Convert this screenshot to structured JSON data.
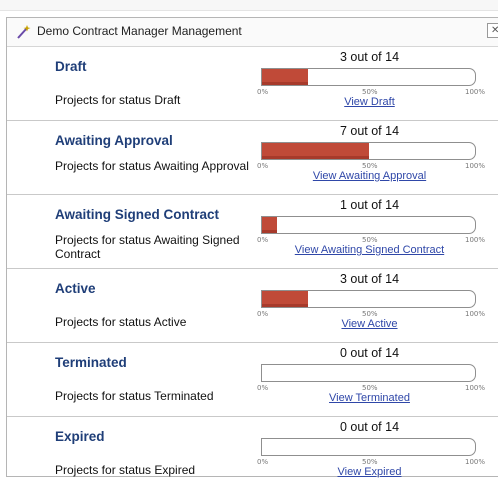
{
  "window": {
    "title": "Demo Contract Manager Management",
    "close_label": "✕",
    "icon": "wand-icon"
  },
  "scale": {
    "min": "0%",
    "mid": "50%",
    "max": "100%"
  },
  "colors": {
    "bar_fill": "#c04a38",
    "title_blue": "#1f3e78",
    "link_blue": "#2f47a8"
  },
  "statuses": [
    {
      "name": "Draft",
      "description": "Projects for status Draft",
      "count_text": "3 out of 14",
      "count": 3,
      "total": 14,
      "link": "View Draft"
    },
    {
      "name": "Awaiting Approval",
      "description": "Projects for status Awaiting Approval",
      "count_text": "7 out of 14",
      "count": 7,
      "total": 14,
      "link": "View Awaiting Approval"
    },
    {
      "name": "Awaiting Signed Contract",
      "description": "Projects for status Awaiting Signed Contract",
      "count_text": "1 out of 14",
      "count": 1,
      "total": 14,
      "link": "View Awaiting Signed Contract"
    },
    {
      "name": "Active",
      "description": "Projects for status Active",
      "count_text": "3 out of 14",
      "count": 3,
      "total": 14,
      "link": "View Active"
    },
    {
      "name": "Terminated",
      "description": "Projects for status Terminated",
      "count_text": "0 out of 14",
      "count": 0,
      "total": 14,
      "link": "View Terminated"
    },
    {
      "name": "Expired",
      "description": "Projects for status Expired",
      "count_text": "0 out of 14",
      "count": 0,
      "total": 14,
      "link": "View Expired"
    }
  ]
}
